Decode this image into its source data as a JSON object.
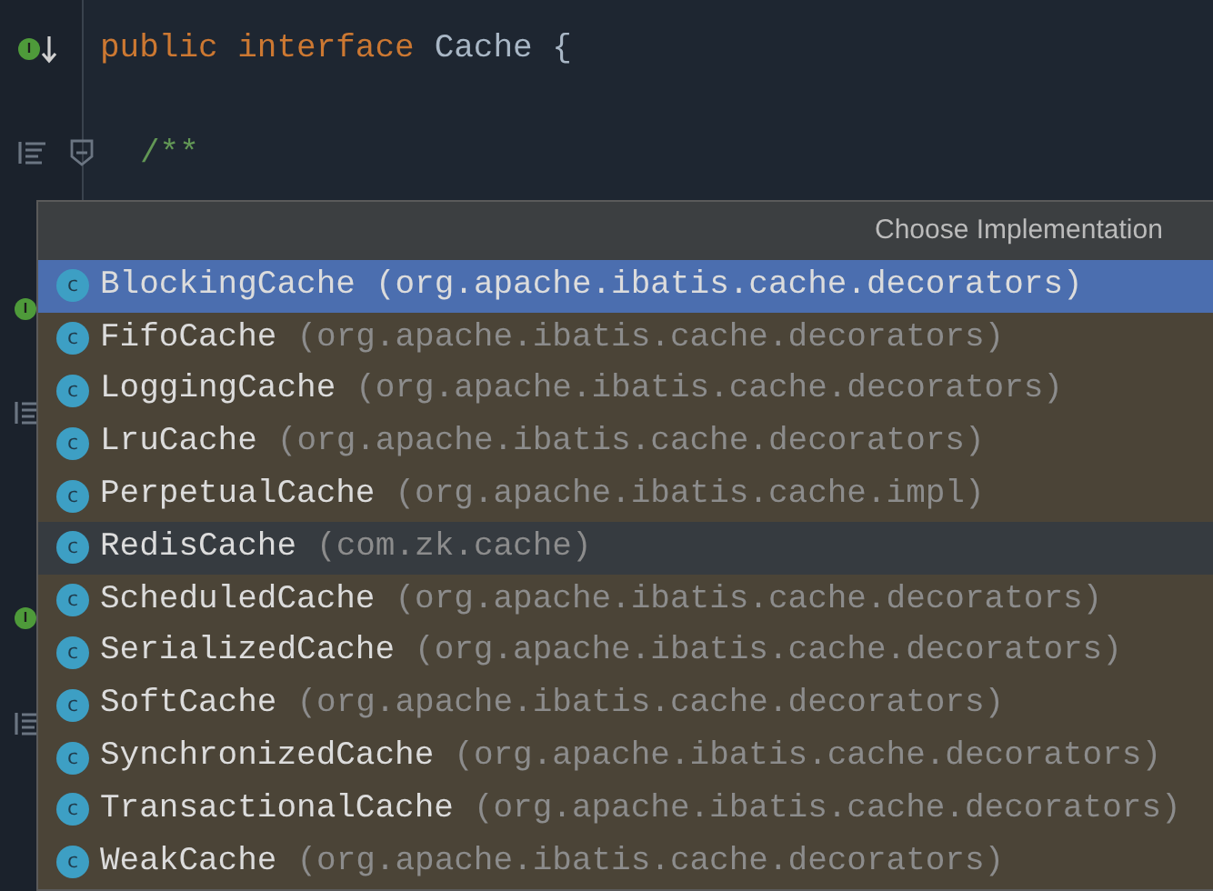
{
  "editor": {
    "lines": [
      {
        "kind": "code",
        "keyword": "public interface",
        "name": "Cache {"
      },
      {
        "kind": "comment",
        "text": "/**"
      }
    ],
    "gutter_markers": [
      {
        "kind": "implemented",
        "letter": "I"
      },
      {
        "kind": "doc"
      },
      {
        "kind": "implemented",
        "letter": "I"
      },
      {
        "kind": "doc"
      },
      {
        "kind": "implemented",
        "letter": "I"
      },
      {
        "kind": "doc"
      }
    ]
  },
  "popup": {
    "title": "Choose Implementation",
    "items": [
      {
        "icon": "c",
        "name": "BlockingCache",
        "package": "(org.apache.ibatis.cache.decorators)",
        "selected": true,
        "hovered": false
      },
      {
        "icon": "c",
        "name": "FifoCache",
        "package": "(org.apache.ibatis.cache.decorators)",
        "selected": false,
        "hovered": false
      },
      {
        "icon": "c",
        "name": "LoggingCache",
        "package": "(org.apache.ibatis.cache.decorators)",
        "selected": false,
        "hovered": false
      },
      {
        "icon": "c",
        "name": "LruCache",
        "package": "(org.apache.ibatis.cache.decorators)",
        "selected": false,
        "hovered": false
      },
      {
        "icon": "c",
        "name": "PerpetualCache",
        "package": "(org.apache.ibatis.cache.impl)",
        "selected": false,
        "hovered": false
      },
      {
        "icon": "c",
        "name": "RedisCache",
        "package": "(com.zk.cache)",
        "selected": false,
        "hovered": true
      },
      {
        "icon": "c",
        "name": "ScheduledCache",
        "package": "(org.apache.ibatis.cache.decorators)",
        "selected": false,
        "hovered": false
      },
      {
        "icon": "c",
        "name": "SerializedCache",
        "package": "(org.apache.ibatis.cache.decorators)",
        "selected": false,
        "hovered": false
      },
      {
        "icon": "c",
        "name": "SoftCache",
        "package": "(org.apache.ibatis.cache.decorators)",
        "selected": false,
        "hovered": false
      },
      {
        "icon": "c",
        "name": "SynchronizedCache",
        "package": "(org.apache.ibatis.cache.decorators)",
        "selected": false,
        "hovered": false
      },
      {
        "icon": "c",
        "name": "TransactionalCache",
        "package": "(org.apache.ibatis.cache.decorators)",
        "selected": false,
        "hovered": false
      },
      {
        "icon": "c",
        "name": "WeakCache",
        "package": "(org.apache.ibatis.cache.decorators)",
        "selected": false,
        "hovered": false
      }
    ]
  }
}
